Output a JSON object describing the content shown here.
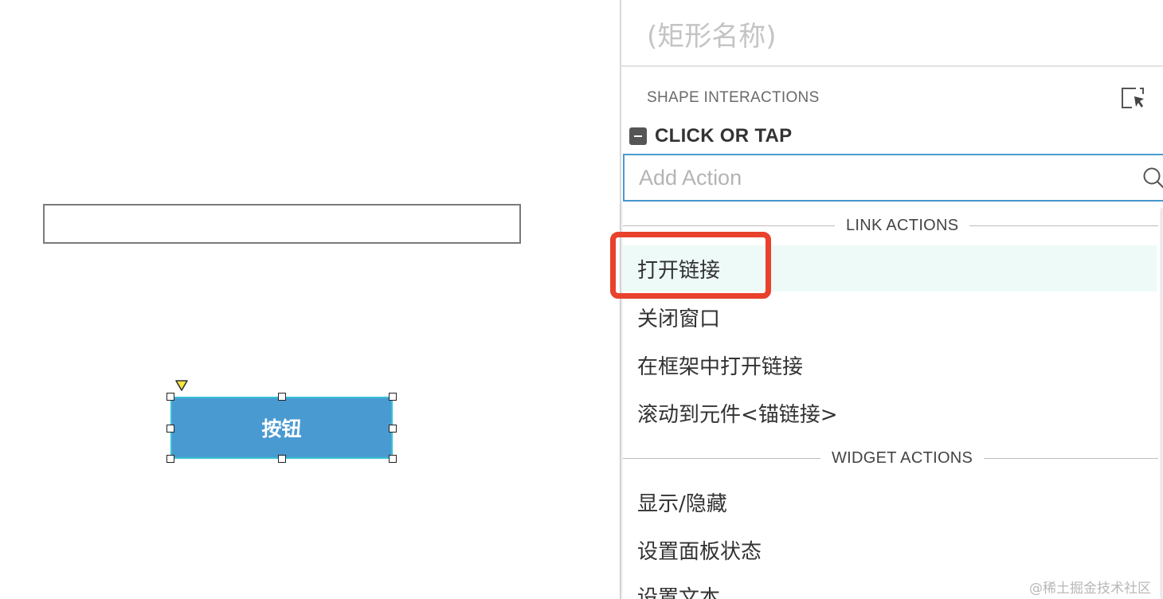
{
  "canvas": {
    "button_label": "按钮"
  },
  "panel": {
    "shape_name": "(矩形名称)",
    "section_title": "SHAPE INTERACTIONS",
    "event_label": "CLICK OR TAP",
    "search": {
      "placeholder": "Add Action",
      "value": ""
    },
    "groups": [
      {
        "label": "LINK ACTIONS",
        "items": [
          "打开链接",
          "关闭窗口",
          "在框架中打开链接",
          "滚动到元件<锚链接>"
        ]
      },
      {
        "label": "WIDGET ACTIONS",
        "items": [
          "显示/隐藏",
          "设置面板状态",
          "设置文本"
        ]
      }
    ],
    "highlighted_item": "打开链接"
  },
  "colors": {
    "button_fill": "#4a9ad2",
    "button_border": "#36c1d4",
    "search_border": "#4a9ad2",
    "highlight_bg": "#eefaf8",
    "callout": "#e8412c",
    "anchor_marker": "#f5e642"
  },
  "icons": {
    "expand": "expand-panel-icon",
    "collapse": "collapse-minus-icon",
    "search": "search-icon",
    "anchor": "triangle-anchor-icon"
  },
  "watermark": "@稀土掘金技术社区"
}
